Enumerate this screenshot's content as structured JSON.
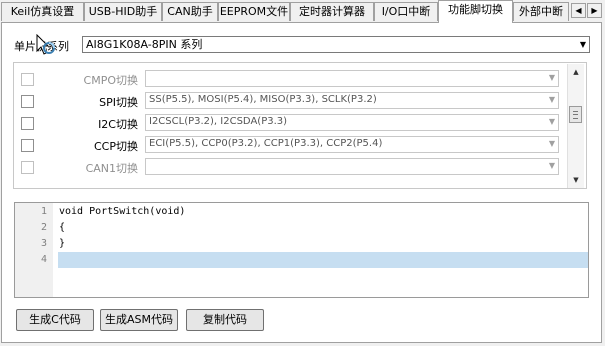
{
  "tabs": [
    {
      "label": "Keil仿真设置",
      "active": false
    },
    {
      "label": "USB-HID助手",
      "active": false
    },
    {
      "label": "CAN助手",
      "active": false
    },
    {
      "label": "EEPROM文件",
      "active": false
    },
    {
      "label": "定时器计算器",
      "active": false
    },
    {
      "label": "I/O口中断",
      "active": false
    },
    {
      "label": "功能脚切换",
      "active": true
    },
    {
      "label": "外部中断",
      "active": false
    }
  ],
  "tab_scroll": {
    "left": "◀",
    "right": "▶"
  },
  "series": {
    "label": "单片机系列",
    "value": "AI8G1K08A-8PIN 系列"
  },
  "rows": [
    {
      "label": "CMPO切换",
      "value": "",
      "enabled": false
    },
    {
      "label": "SPI切换",
      "value": "SS(P5.5), MOSI(P5.4), MISO(P3.3), SCLK(P3.2)",
      "enabled": true
    },
    {
      "label": "I2C切换",
      "value": "I2CSCL(P3.2), I2CSDA(P3.3)",
      "enabled": true
    },
    {
      "label": "CCP切换",
      "value": "ECI(P5.5), CCP0(P3.2), CCP1(P3.3), CCP2(P5.4)",
      "enabled": true
    },
    {
      "label": "CAN1切换",
      "value": "",
      "enabled": false
    }
  ],
  "code_lines": [
    {
      "num": "1",
      "text": "void PortSwitch(void)"
    },
    {
      "num": "2",
      "text": "{"
    },
    {
      "num": "3",
      "text": "}"
    },
    {
      "num": "4",
      "text": ""
    }
  ],
  "buttons": {
    "gen_c": "生成C代码",
    "gen_asm": "生成ASM代码",
    "copy": "复制代码"
  },
  "colors": {
    "current_line": "#c6def1",
    "accent": "#3c7fb1"
  }
}
